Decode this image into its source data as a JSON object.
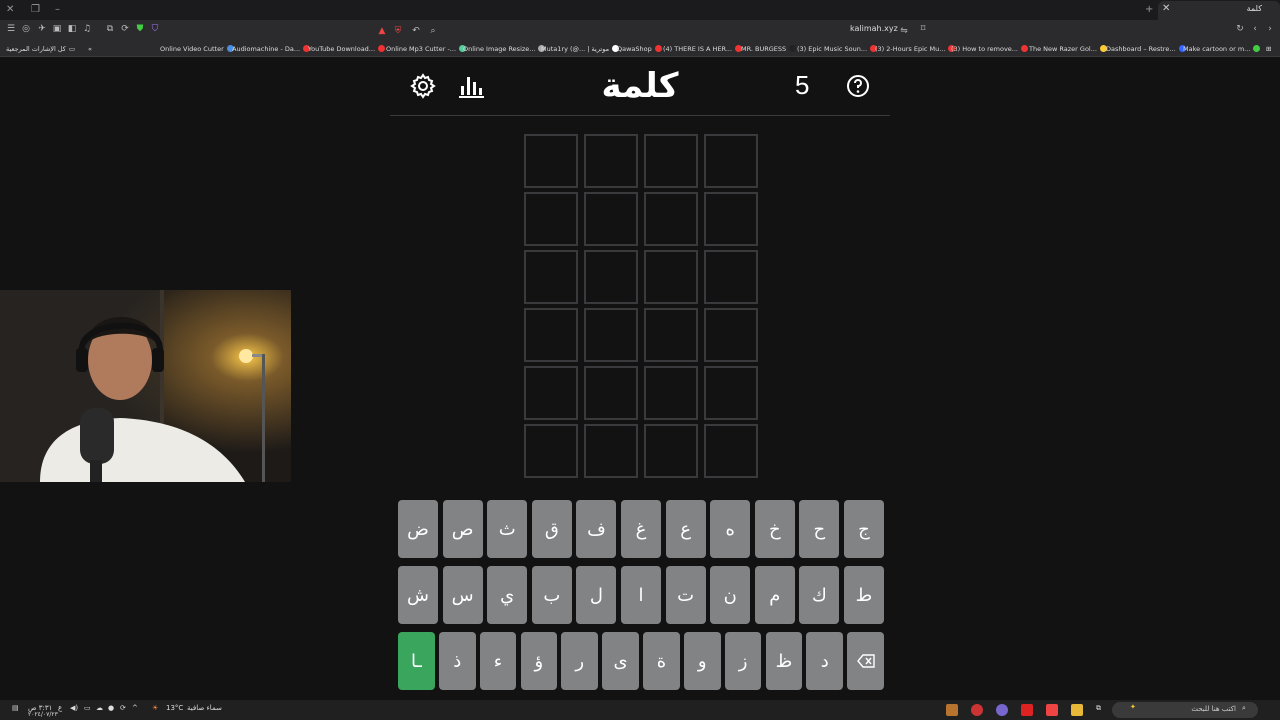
{
  "browser": {
    "tab_title": "كلمة",
    "url": "kalimah.xyz",
    "bookmarks_folder": "كل الإشارات المرجعية",
    "bookmarks": [
      {
        "label": "Online Video Cutter",
        "color": "#4a90e2"
      },
      {
        "label": "Audiomachine - Da...",
        "color": "#e33"
      },
      {
        "label": "YouTube Download...",
        "color": "#e33"
      },
      {
        "label": "Online Mp3 Cutter -...",
        "color": "#5c9"
      },
      {
        "label": "Online Image Resize...",
        "color": "#aaa"
      },
      {
        "label": "Muta1ry (@... | موترية",
        "color": "#fff"
      },
      {
        "label": "QawaShop",
        "color": "#e33"
      },
      {
        "label": "(4) THERE IS A HER...",
        "color": "#e33"
      },
      {
        "label": "MR. BURGESS",
        "color": "#222"
      },
      {
        "label": "(3) Epic Music Soun...",
        "color": "#e33"
      },
      {
        "label": "(3) 2-Hours Epic Mu...",
        "color": "#e33"
      },
      {
        "label": "(3) How to remove...",
        "color": "#e33"
      },
      {
        "label": "The New Razer Gol...",
        "color": "#fc3"
      },
      {
        "label": "Dashboard – Restre...",
        "color": "#36f"
      },
      {
        "label": "Make cartoon or m...",
        "color": "#4c4"
      }
    ]
  },
  "game": {
    "title": "كلمة",
    "word_length": "5",
    "icons": {
      "settings": "gear-icon",
      "stats": "bar-chart-icon",
      "help": "question-icon"
    }
  },
  "board": {
    "rows": 6,
    "cols": 4,
    "cells": [
      [
        "",
        "",
        "",
        ""
      ],
      [
        "",
        "",
        "",
        ""
      ],
      [
        "",
        "",
        "",
        ""
      ],
      [
        "",
        "",
        "",
        ""
      ],
      [
        "",
        "",
        "",
        ""
      ],
      [
        "",
        "",
        "",
        ""
      ]
    ]
  },
  "keyboard": {
    "row1": [
      "ج",
      "ح",
      "خ",
      "ه",
      "ع",
      "غ",
      "ف",
      "ق",
      "ث",
      "ص",
      "ض"
    ],
    "row2": [
      "ط",
      "ك",
      "م",
      "ن",
      "ت",
      "ا",
      "ل",
      "ب",
      "ي",
      "س",
      "ش"
    ],
    "row3": [
      "⌫",
      "د",
      "ظ",
      "ز",
      "و",
      "ة",
      "ى",
      "ر",
      "ؤ",
      "ء",
      "ذ",
      "ـا"
    ],
    "enter_label": "ـا",
    "colors": {
      "key": "#818384",
      "enter": "#3aa55d",
      "tile_border": "#3a3a3c",
      "background": "#121213"
    }
  },
  "taskbar": {
    "search_placeholder": "اكتب هنا للبحث",
    "weather_temp": "13°C",
    "weather_desc": "سماء صافية",
    "time": "٣:٣١ ص",
    "date": "٢٠٢٤/٠٧/٢٣",
    "lang": "ع"
  }
}
